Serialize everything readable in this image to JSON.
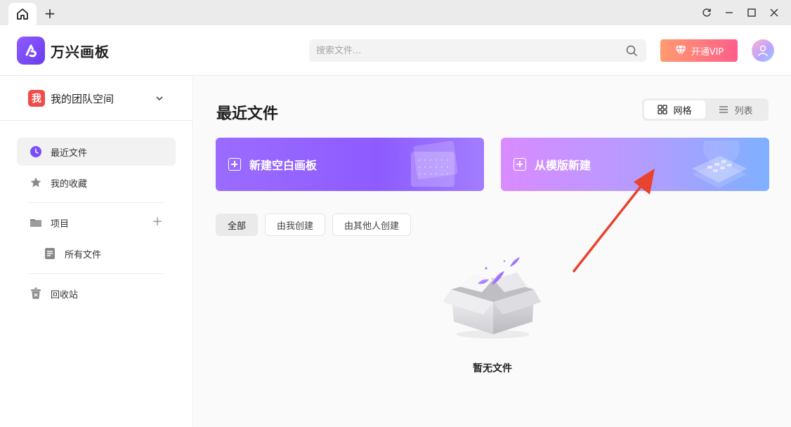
{
  "titlebar": {
    "tab_add_label": "+"
  },
  "header": {
    "app_name": "万兴画板",
    "search_placeholder": "搜索文件...",
    "vip_label": "开通VIP"
  },
  "sidebar": {
    "team": {
      "badge": "我",
      "name": "我的团队空间"
    },
    "items": [
      {
        "label": "最近文件",
        "icon": "clock-icon",
        "active": true
      },
      {
        "label": "我的收藏",
        "icon": "star-icon"
      },
      {
        "label": "项目",
        "icon": "folder-icon"
      },
      {
        "label": "所有文件",
        "icon": "file-icon"
      },
      {
        "label": "回收站",
        "icon": "trash-icon"
      }
    ]
  },
  "main": {
    "title": "最近文件",
    "view_toggle": {
      "grid": "网格",
      "list": "列表",
      "selected": "grid"
    },
    "cards": {
      "blank": "新建空白画板",
      "template": "从模版新建"
    },
    "filters": [
      "全部",
      "由我创建",
      "由其他人创建"
    ],
    "empty_text": "暂无文件"
  },
  "colors": {
    "accent": "#7b4dff",
    "vip_gradient_start": "#ff9b6e",
    "vip_gradient_end": "#ff5e8a",
    "annotation_arrow": "#e8432e"
  }
}
